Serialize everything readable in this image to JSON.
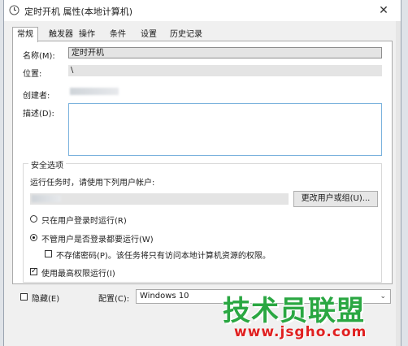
{
  "window": {
    "title": "定时开机 属性(本地计算机)",
    "close_glyph": "✕"
  },
  "tabs": [
    {
      "label": "常规",
      "active": true
    },
    {
      "label": "触发器"
    },
    {
      "label": "操作"
    },
    {
      "label": "条件"
    },
    {
      "label": "设置"
    },
    {
      "label": "历史记录"
    }
  ],
  "general": {
    "name_label": "名称(M):",
    "name_value": "定时开机",
    "location_label": "位置:",
    "location_value": "\\",
    "author_label": "创建者:",
    "description_label": "描述(D):"
  },
  "security": {
    "group_title": "安全选项",
    "run_as_text": "运行任务时，请使用下列用户帐户:",
    "change_user_button": "更改用户或组(U)...",
    "radio_logged_on": "只在用户登录时运行(R)",
    "radio_whether_logged": "不管用户是否登录都要运行(W)",
    "no_store_password": "不存储密码(P)。该任务将只有访问本地计算机资源的权限。",
    "highest_privileges": "使用最高权限运行(I)"
  },
  "bottom": {
    "hidden_label": "隐藏(E)",
    "configure_label": "配置(C):",
    "configure_value": "Windows 10"
  },
  "watermark": {
    "text": "技术员联盟",
    "url": "www.jsgho.com"
  },
  "colors": {
    "accent_border": "#7ab2dd",
    "watermark_green": "#2aa742",
    "watermark_red": "#e02020"
  }
}
